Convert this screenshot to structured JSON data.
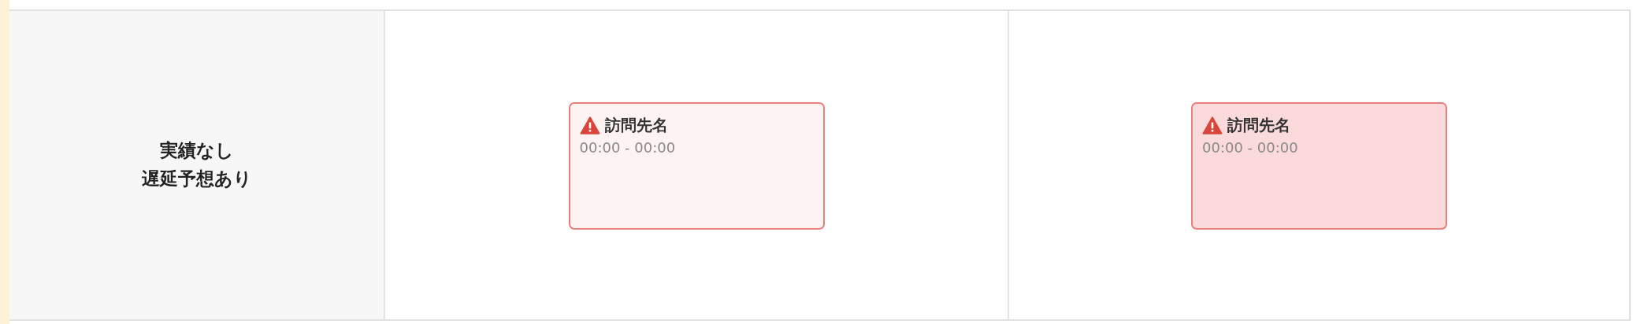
{
  "row_label": {
    "lines": [
      "実績なし",
      "遅延予想あり"
    ]
  },
  "cells": [
    {
      "visit": {
        "name": "訪問先名",
        "time": "00:00 - 00:00",
        "warning": true,
        "highlighted": false
      }
    },
    {
      "visit": {
        "name": "訪問先名",
        "time": "00:00 - 00:00",
        "warning": true,
        "highlighted": true
      }
    }
  ]
}
